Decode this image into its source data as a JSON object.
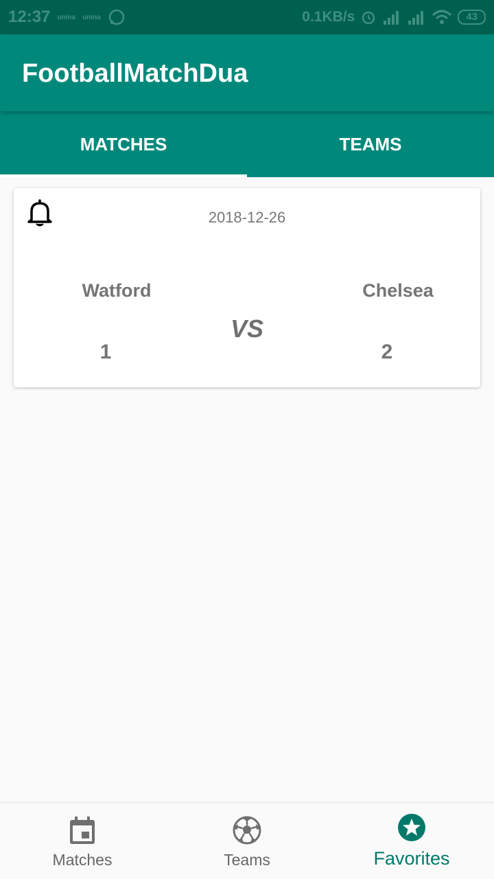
{
  "status_bar": {
    "time": "12:37",
    "carrier_1": "unina",
    "carrier_2": "unina",
    "net_speed": "0.1KB/s",
    "battery": "43"
  },
  "app_bar": {
    "title": "FootballMatchDua"
  },
  "tabs": [
    {
      "label": "MATCHES",
      "active": true
    },
    {
      "label": "TEAMS",
      "active": false
    }
  ],
  "match": {
    "date": "2018-12-26",
    "home_team": "Watford",
    "away_team": "Chelsea",
    "vs_label": "VS",
    "home_score": "1",
    "away_score": "2",
    "reminder_icon": "bell-icon"
  },
  "bottom_nav": [
    {
      "label": "Matches",
      "icon": "calendar-icon",
      "active": false
    },
    {
      "label": "Teams",
      "icon": "soccer-ball-icon",
      "active": false
    },
    {
      "label": "Favorites",
      "icon": "star-icon",
      "active": true
    }
  ],
  "colors": {
    "primary": "#00897b",
    "primary_dark": "#00604f",
    "accent": "#00796b",
    "text_secondary": "#757575"
  }
}
